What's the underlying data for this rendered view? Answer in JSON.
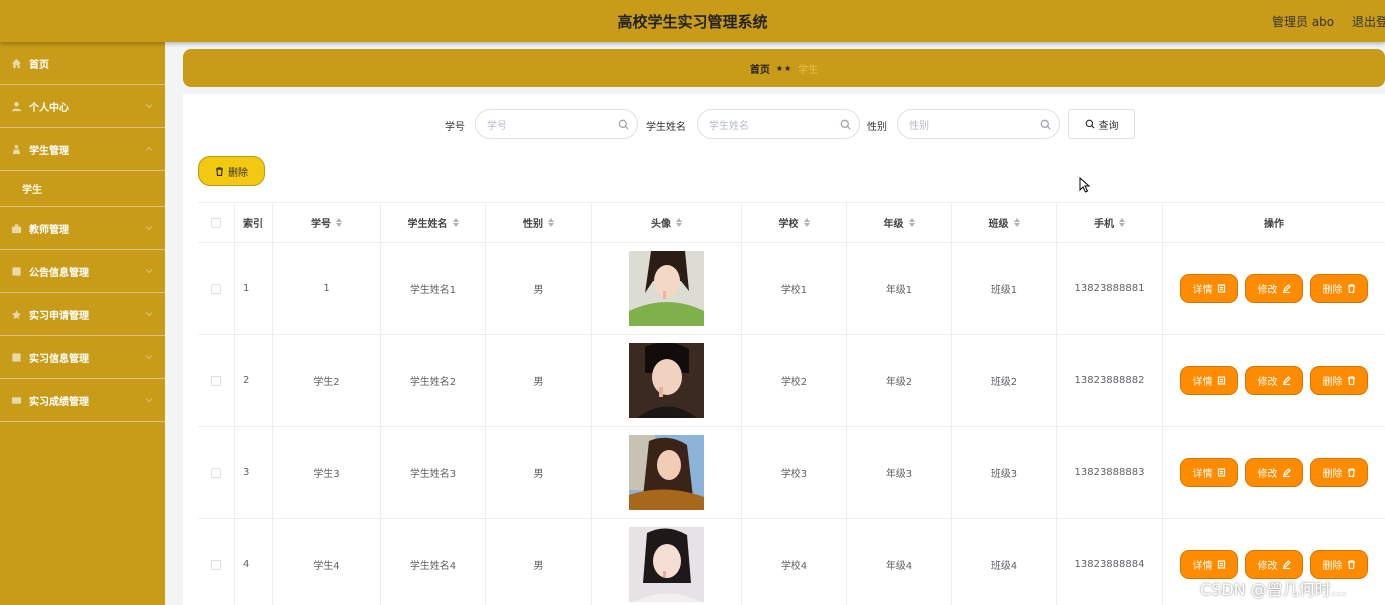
{
  "header": {
    "title": "高校学生实习管理系统",
    "user": "管理员 abo",
    "logout": "退出登"
  },
  "sidebar": {
    "items": [
      {
        "label": "首页",
        "icon": "home-icon"
      },
      {
        "label": "个人中心",
        "icon": "user-icon"
      },
      {
        "label": "学生管理",
        "icon": "students-icon"
      },
      {
        "label": "学生",
        "sub": true
      },
      {
        "label": "教师管理",
        "icon": "teacher-icon"
      },
      {
        "label": "公告信息管理",
        "icon": "notice-icon"
      },
      {
        "label": "实习申请管理",
        "icon": "apply-icon"
      },
      {
        "label": "实习信息管理",
        "icon": "info-icon"
      },
      {
        "label": "实习成绩管理",
        "icon": "grade-icon"
      }
    ]
  },
  "breadcrumb": {
    "home": "首页",
    "sep": "★★",
    "current": "学生"
  },
  "search": {
    "student_id_label": "学号",
    "student_id_placeholder": "学号",
    "name_label": "学生姓名",
    "name_placeholder": "学生姓名",
    "gender_label": "性别",
    "gender_placeholder": "性别",
    "query_label": "查询"
  },
  "toolbar": {
    "delete_label": "删除"
  },
  "table": {
    "headers": {
      "index": "索引",
      "student_id": "学号",
      "name": "学生姓名",
      "gender": "性别",
      "avatar": "头像",
      "school": "学校",
      "grade": "年级",
      "class": "班级",
      "phone": "手机",
      "actions": "操作"
    },
    "rows": [
      {
        "index": "1",
        "student_id": "1",
        "name": "学生姓名1",
        "gender": "男",
        "school": "学校1",
        "grade": "年级1",
        "class": "班级1",
        "phone": "13823888881"
      },
      {
        "index": "2",
        "student_id": "学生2",
        "name": "学生姓名2",
        "gender": "男",
        "school": "学校2",
        "grade": "年级2",
        "class": "班级2",
        "phone": "13823888882"
      },
      {
        "index": "3",
        "student_id": "学生3",
        "name": "学生姓名3",
        "gender": "男",
        "school": "学校3",
        "grade": "年级3",
        "class": "班级3",
        "phone": "13823888883"
      },
      {
        "index": "4",
        "student_id": "学生4",
        "name": "学生姓名4",
        "gender": "男",
        "school": "学校4",
        "grade": "年级4",
        "class": "班级4",
        "phone": "13823888884"
      }
    ],
    "actions": {
      "detail": "详情",
      "edit": "修改",
      "delete": "删除"
    }
  },
  "watermark": "CSDN @曾几何时…",
  "colors": {
    "brand": "#c89c18",
    "action": "#ff8c00",
    "delete_button": "#f2c811"
  }
}
